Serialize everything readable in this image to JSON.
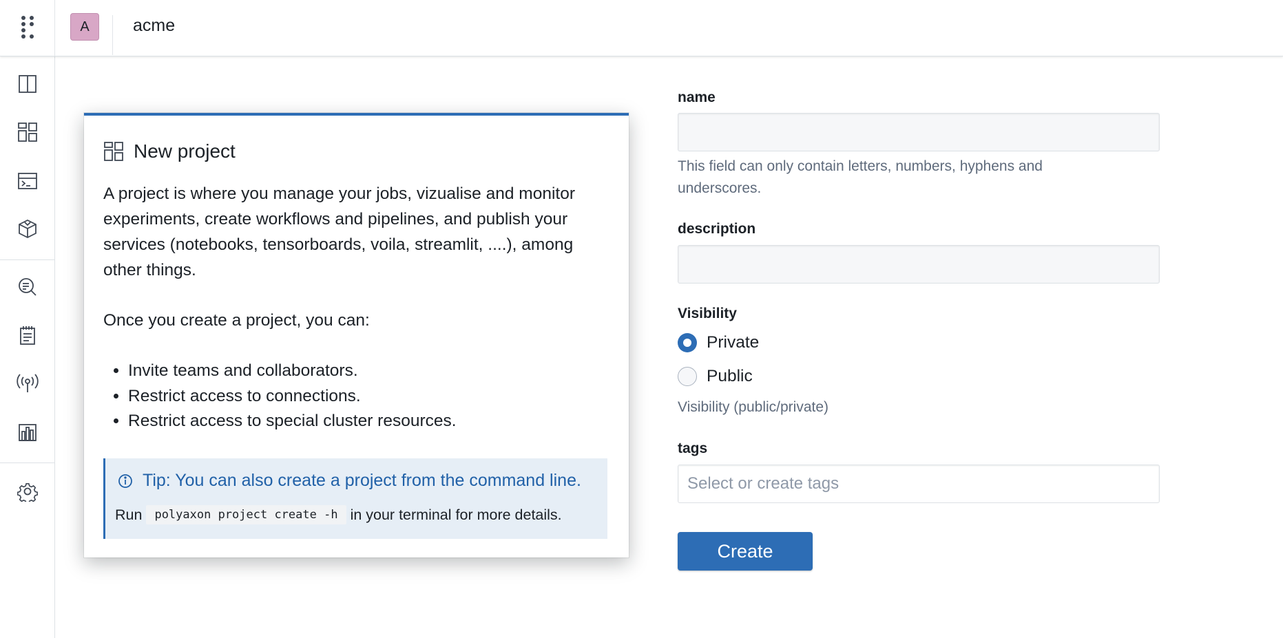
{
  "header": {
    "org_initial": "A",
    "org_name": "acme"
  },
  "sidebar": {
    "items": [
      {
        "icon": "panel-columns-icon"
      },
      {
        "icon": "dashboard-grid-icon"
      },
      {
        "icon": "terminal-window-icon"
      },
      {
        "icon": "package-box-icon"
      },
      {
        "icon": "search-list-icon"
      },
      {
        "icon": "notebook-icon"
      },
      {
        "icon": "broadcast-antenna-icon"
      },
      {
        "icon": "chart-building-icon"
      },
      {
        "icon": "gear-icon"
      }
    ]
  },
  "card": {
    "title": "New project",
    "intro": "A project is where you manage your jobs, vizualise and monitor experiments, create workflows and pipelines, and publish your services (notebooks, tensorboards, voila, streamlit, ....), among other things.",
    "lead": "Once you create a project, you can:",
    "bullets": [
      "Invite teams and collaborators.",
      "Restrict access to connections.",
      "Restrict access to special cluster resources."
    ],
    "tip": {
      "title": "Tip: You can also create a project from the command line.",
      "prefix": "Run",
      "command": "polyaxon project create -h",
      "suffix": "in your terminal for more details."
    }
  },
  "form": {
    "name_label": "name",
    "name_value": "",
    "name_help_line1": "This field can only contain letters, numbers, hyphens and",
    "name_help_line2": "underscores.",
    "description_label": "description",
    "description_value": "",
    "visibility_label": "Visibility",
    "visibility_options": [
      "Private",
      "Public"
    ],
    "visibility_selected": "Private",
    "visibility_help": "Visibility (public/private)",
    "tags_label": "tags",
    "tags_placeholder": "Select or create tags",
    "submit_label": "Create"
  },
  "colors": {
    "accent": "#2d6db5",
    "avatar": "#d8a7c6",
    "callout_bg": "#e6eef6"
  }
}
